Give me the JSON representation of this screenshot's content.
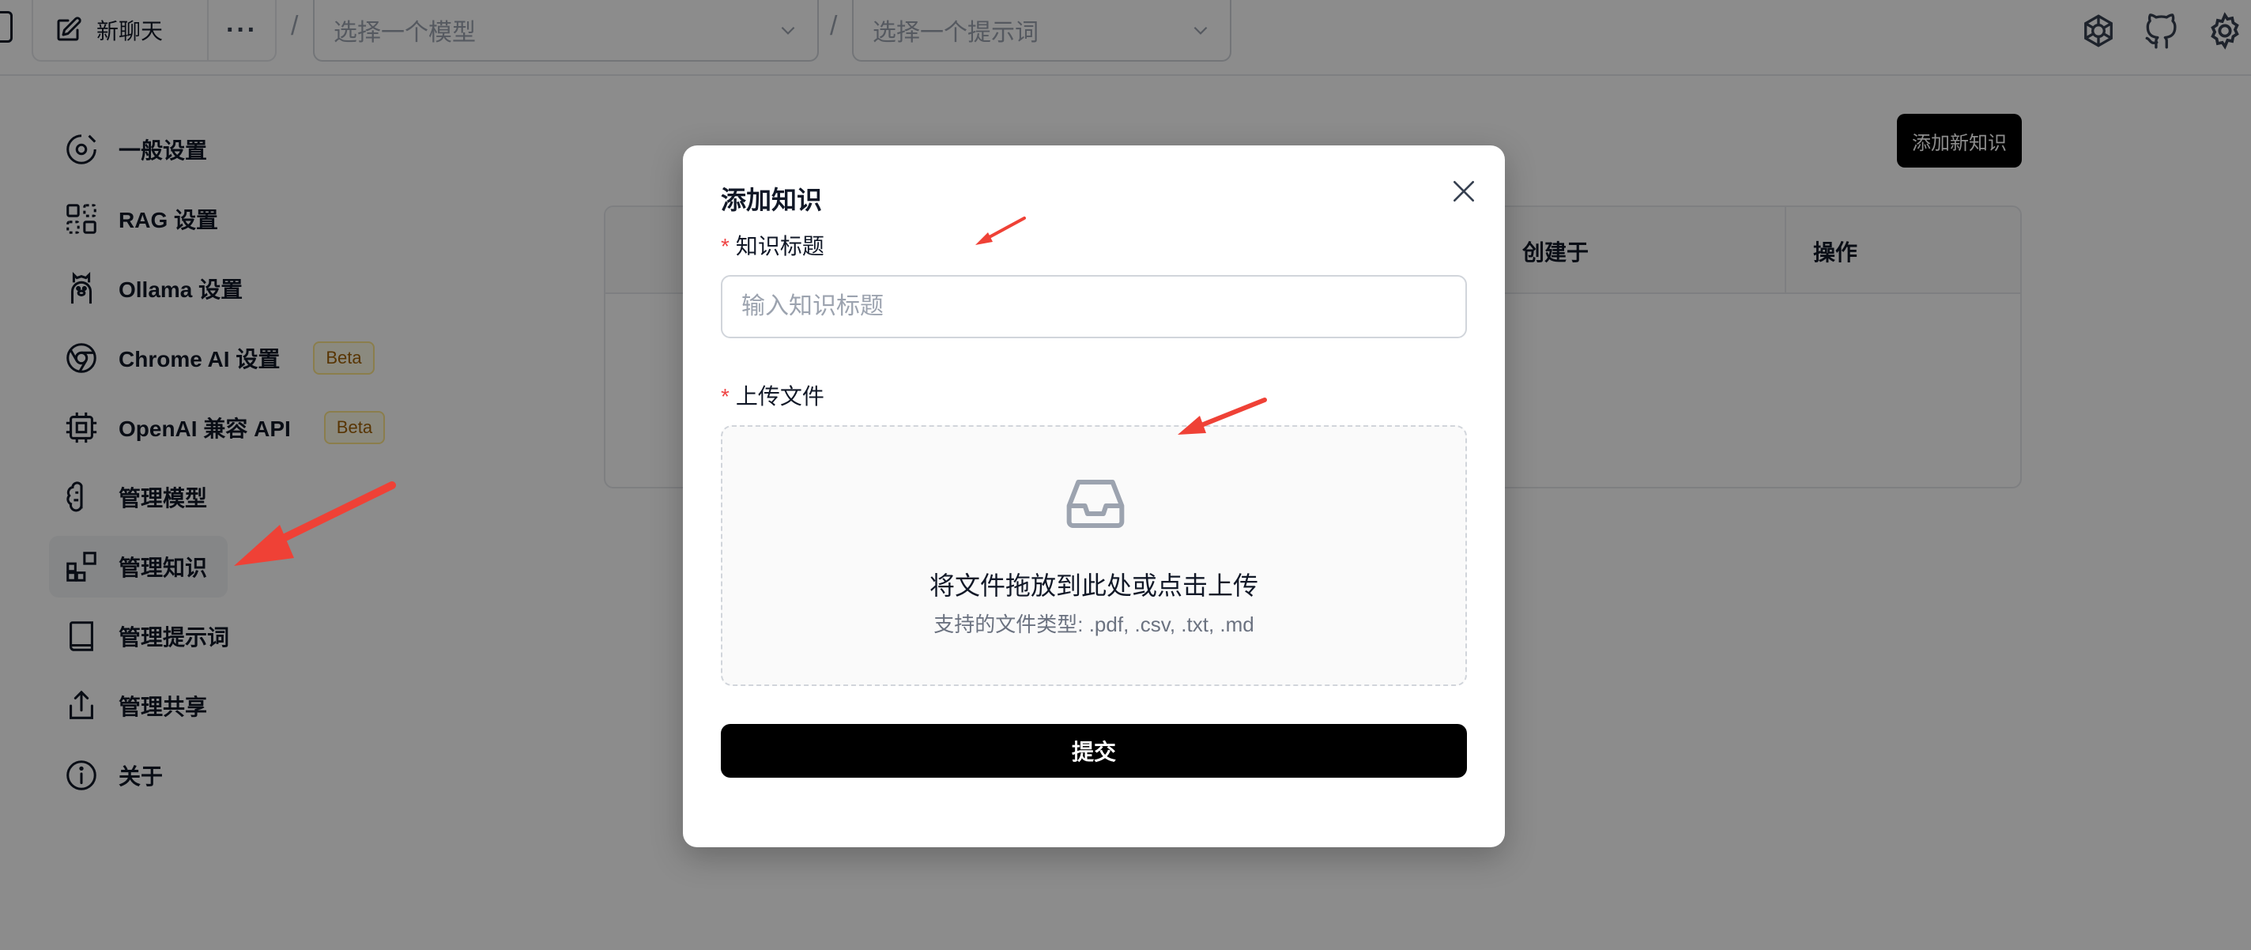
{
  "topbar": {
    "new_chat_label": "新聊天",
    "more_label": "···",
    "separator": "/",
    "model_placeholder": "选择一个模型",
    "prompt_placeholder": "选择一个提示词"
  },
  "sidebar": {
    "items": [
      {
        "label": "一般设置",
        "icon": "general-settings-icon"
      },
      {
        "label": "RAG 设置",
        "icon": "rag-icon"
      },
      {
        "label": "Ollama 设置",
        "icon": "ollama-icon"
      },
      {
        "label": "Chrome AI 设置",
        "icon": "chrome-icon",
        "badge": "Beta"
      },
      {
        "label": "OpenAI 兼容 API",
        "icon": "cpu-icon",
        "badge": "Beta"
      },
      {
        "label": "管理模型",
        "icon": "brain-icon"
      },
      {
        "label": "管理知识",
        "icon": "blocks-icon",
        "active": true
      },
      {
        "label": "管理提示词",
        "icon": "book-icon"
      },
      {
        "label": "管理共享",
        "icon": "share-icon"
      },
      {
        "label": "关于",
        "icon": "info-icon"
      }
    ]
  },
  "main": {
    "add_button": "添加新知识",
    "table_headers": [
      "创建于",
      "操作"
    ]
  },
  "modal": {
    "title": "添加知识",
    "title_field_label": "知识标题",
    "title_field_placeholder": "输入知识标题",
    "required_mark": "*",
    "upload_label": "上传文件",
    "drop_text": "将文件拖放到此处或点击上传",
    "supported_types": "支持的文件类型: .pdf, .csv, .txt, .md",
    "submit_label": "提交"
  },
  "colors": {
    "accent": "#000000",
    "required": "#ef4444",
    "arrow": "#ef4136",
    "badge_text": "#a16207",
    "badge_bg": "#fefce8"
  }
}
